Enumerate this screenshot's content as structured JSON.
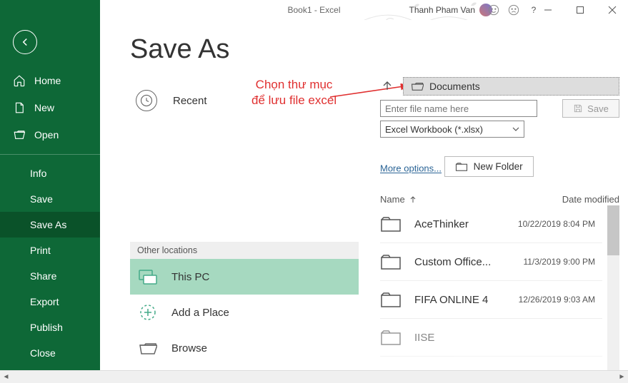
{
  "titlebar": {
    "title": "Book1 - Excel",
    "user": "Thanh Pham Van",
    "help": "?"
  },
  "sidebar": {
    "home": "Home",
    "new": "New",
    "open": "Open",
    "info": "Info",
    "save": "Save",
    "saveas": "Save As",
    "print": "Print",
    "share": "Share",
    "export": "Export",
    "publish": "Publish",
    "close": "Close"
  },
  "page": {
    "title": "Save As",
    "recent": "Recent",
    "other_locations": "Other locations",
    "this_pc": "This PC",
    "add_place": "Add a Place",
    "browse": "Browse"
  },
  "annotation": {
    "line1": "Chọn thư mục",
    "line2": "để lưu file excel"
  },
  "right": {
    "path_label": "Documents",
    "filename_placeholder": "Enter file name here",
    "filetype": "Excel Workbook (*.xlsx)",
    "save": "Save",
    "more_options": "More options...",
    "new_folder": "New Folder",
    "col_name": "Name",
    "col_date": "Date modified",
    "files": [
      {
        "name": "AceThinker",
        "date": "10/22/2019 8:04 PM"
      },
      {
        "name": "Custom Office...",
        "date": "11/3/2019 9:00 PM"
      },
      {
        "name": "FIFA ONLINE 4",
        "date": "12/26/2019 9:03 AM"
      },
      {
        "name": "IISE",
        "date": ""
      }
    ]
  }
}
